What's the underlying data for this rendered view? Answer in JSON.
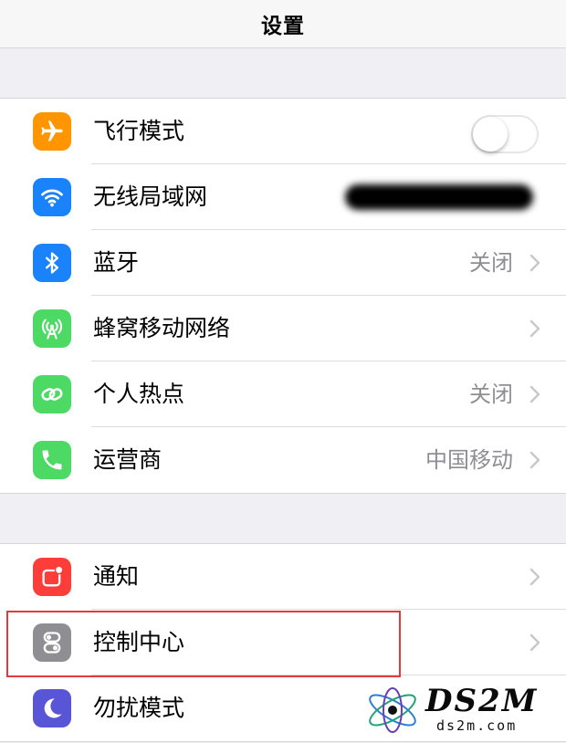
{
  "header": {
    "title": "设置"
  },
  "group1": {
    "items": [
      {
        "label": "飞行模式",
        "icon": "airplane-icon",
        "color": "#ff9500",
        "toggle": false
      },
      {
        "label": "无线局域网",
        "icon": "wifi-icon",
        "color": "#1a82fb"
      },
      {
        "label": "蓝牙",
        "icon": "bluetooth-icon",
        "color": "#1a82fb",
        "value": "关闭"
      },
      {
        "label": "蜂窝移动网络",
        "icon": "cellular-antenna-icon",
        "color": "#4cd964"
      },
      {
        "label": "个人热点",
        "icon": "hotspot-link-icon",
        "color": "#4cd964",
        "value": "关闭"
      },
      {
        "label": "运营商",
        "icon": "phone-icon",
        "color": "#4cd964",
        "value": "中国移动"
      }
    ]
  },
  "group2": {
    "items": [
      {
        "label": "通知",
        "icon": "notification-icon",
        "color": "#fc3d39"
      },
      {
        "label": "控制中心",
        "icon": "control-center-icon",
        "color": "#8e8e93",
        "highlighted": true
      },
      {
        "label": "勿扰模式",
        "icon": "moon-icon",
        "color": "#5856d6"
      }
    ]
  },
  "watermark": {
    "brand": "DS2M",
    "domain": "ds2m.com"
  },
  "colors": {
    "highlight": "#e33b3b",
    "background": "#efeff4"
  }
}
